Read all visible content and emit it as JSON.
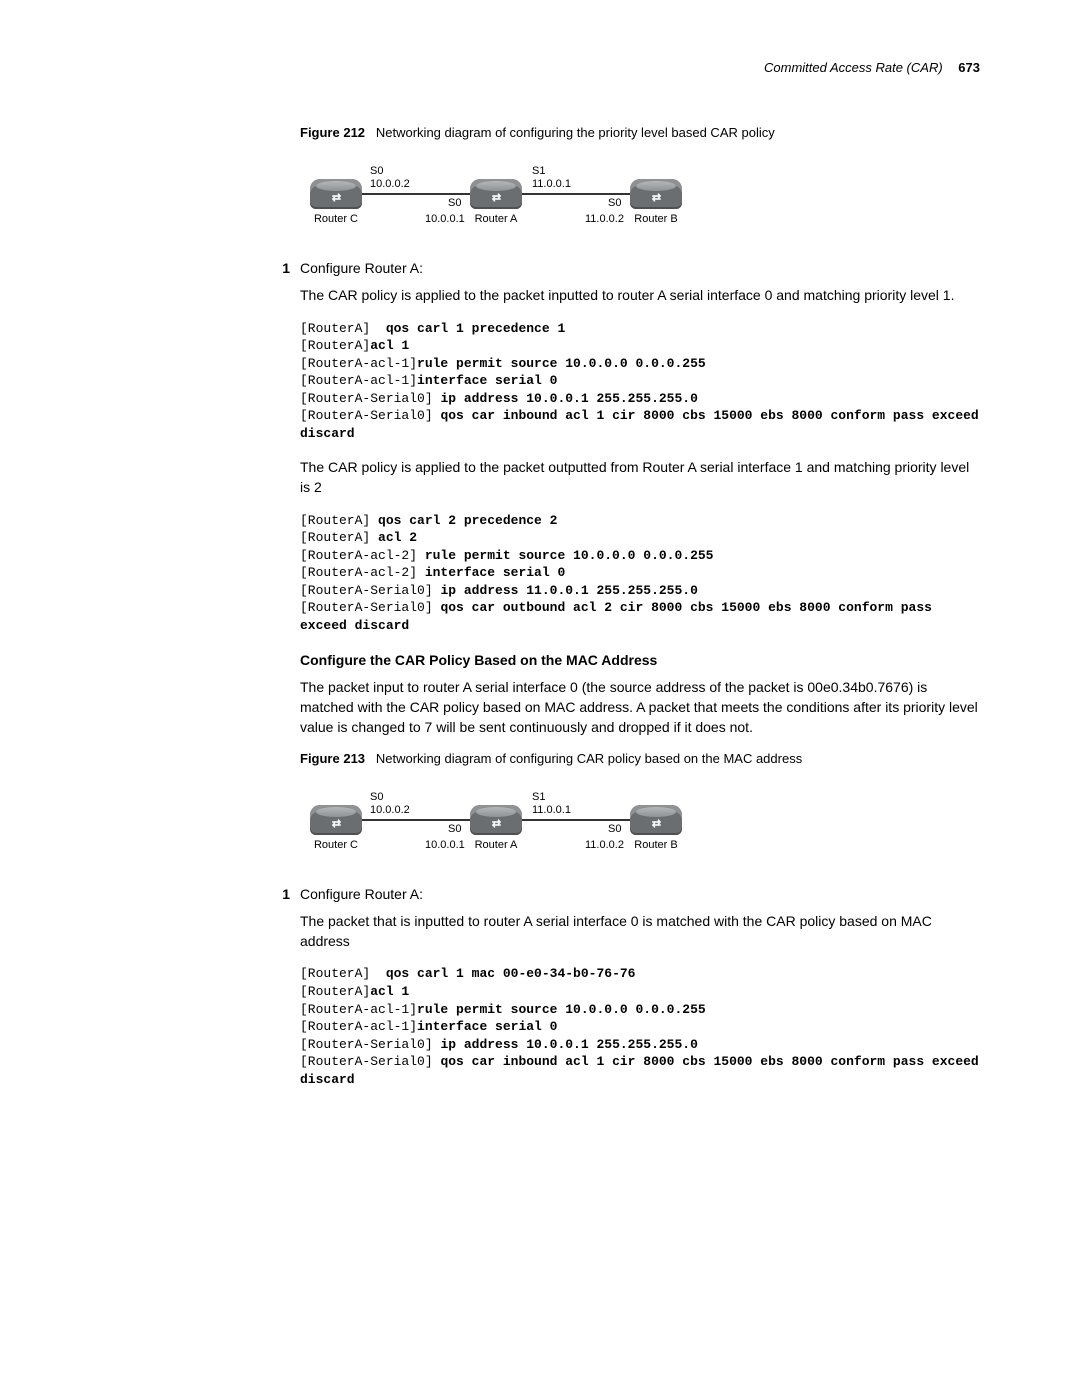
{
  "header": {
    "title": "Committed Access Rate (CAR)",
    "page": "673"
  },
  "fig212": {
    "label": "Figure 212",
    "caption": "Networking diagram of configuring the priority level based CAR policy"
  },
  "diagram": {
    "routerC": "Router C",
    "routerA": "Router A",
    "routerB": "Router B",
    "s0_top_left": "S0",
    "ip_tl": "10.0.0.2",
    "s0_bot_left": "S0",
    "ip_bl": "10.0.0.1",
    "s1_top_right": "S1",
    "ip_tr": "11.0.0.1",
    "s0_bot_right": "S0",
    "ip_br": "11.0.0.2"
  },
  "step1a": {
    "num": "1",
    "text": "Configure Router A:"
  },
  "para1": "The CAR policy is applied to the packet inputted to router A serial interface 0 and matching priority level 1.",
  "code1": {
    "l1a": "[RouterA]  ",
    "l1b": "qos carl 1 precedence 1",
    "l2a": "[RouterA]",
    "l2b": "acl 1",
    "l3a": "[RouterA-acl-1]",
    "l3b": "rule permit source 10.0.0.0 0.0.0.255",
    "l4a": "[RouterA-acl-1]",
    "l4b": "interface serial 0",
    "l5a": "[RouterA-Serial0] ",
    "l5b": "ip address 10.0.0.1 255.255.255.0",
    "l6a": "[RouterA-Serial0] ",
    "l6b": "qos car inbound acl 1 cir 8000 cbs 15000 ebs 8000 conform pass exceed discard"
  },
  "para2": "The CAR policy is applied to the packet outputted from Router A serial interface 1 and matching priority level is 2",
  "code2": {
    "l1a": "[RouterA] ",
    "l1b": "qos carl 2 precedence 2",
    "l2a": "[RouterA] ",
    "l2b": "acl 2",
    "l3a": "[RouterA-acl-2] ",
    "l3b": "rule permit source 10.0.0.0 0.0.0.255",
    "l4a": "[RouterA-acl-2] ",
    "l4b": "interface serial 0",
    "l5a": "[RouterA-Serial0] ",
    "l5b": "ip address 11.0.0.1 255.255.255.0",
    "l6a": "[RouterA-Serial0] ",
    "l6b": "qos car outbound acl 2 cir 8000 cbs 15000 ebs 8000 conform pass exceed discard"
  },
  "section2": "Configure the CAR Policy Based on the MAC Address",
  "para3": "The packet input to router A serial interface 0 (the source address of the packet is 00e0.34b0.7676) is matched with the CAR policy based on MAC address. A packet that meets the conditions after its priority level value is changed to 7 will be sent continuously and dropped if it does not.",
  "fig213": {
    "label": "Figure 213",
    "caption": "Networking diagram of configuring CAR policy based on the MAC address"
  },
  "step1b": {
    "num": "1",
    "text": "Configure Router A:"
  },
  "para4": "The packet that is inputted to router A serial interface 0 is matched with the CAR policy based on MAC address",
  "code3": {
    "l1a": "[RouterA]  ",
    "l1b": "qos carl 1 mac 00-e0-34-b0-76-76",
    "l2a": "[RouterA]",
    "l2b": "acl 1",
    "l3a": "[RouterA-acl-1]",
    "l3b": "rule permit source 10.0.0.0 0.0.0.255",
    "l4a": "[RouterA-acl-1]",
    "l4b": "interface serial 0",
    "l5a": "[RouterA-Serial0] ",
    "l5b": "ip address 10.0.0.1 255.255.255.0",
    "l6a": "[RouterA-Serial0] ",
    "l6b": "qos car inbound acl 1 cir 8000 cbs 15000 ebs 8000 conform pass exceed discard"
  }
}
